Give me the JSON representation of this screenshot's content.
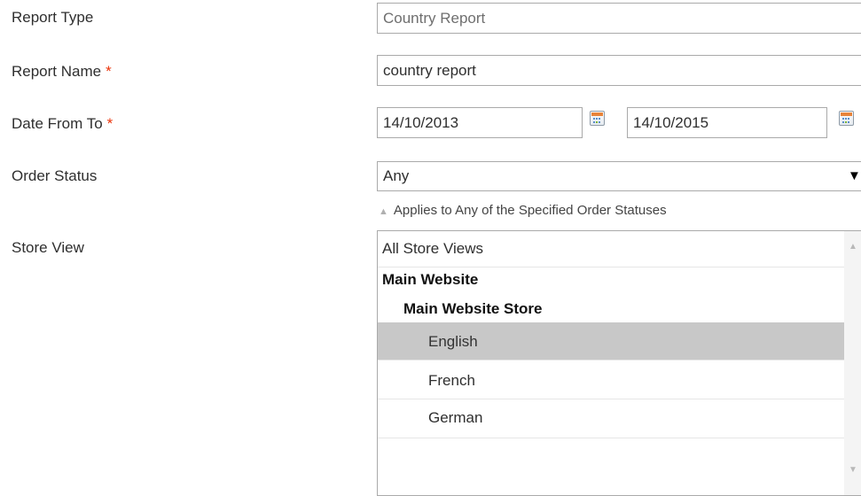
{
  "form": {
    "report_type": {
      "label": "Report Type",
      "value": "Country Report"
    },
    "report_name": {
      "label": "Report Name",
      "required_mark": "*",
      "value": "country report"
    },
    "date_range": {
      "label": "Date From To",
      "required_mark": "*",
      "from": "14/10/2013",
      "to": "14/10/2015"
    },
    "order_status": {
      "label": "Order Status",
      "selected": "Any",
      "dropdown_arrow": "▼",
      "note_icon": "▲",
      "note": "Applies to Any of the Specified Order Statuses"
    },
    "store_view": {
      "label": "Store View",
      "options": {
        "all": "All Store Views",
        "website": "Main Website",
        "store": "Main Website Store",
        "view_1": "English",
        "view_2": "French",
        "view_3": "German"
      },
      "selected": "English",
      "scroll_up": "▲",
      "scroll_down": "▼"
    }
  },
  "colors": {
    "required": "#eb340a",
    "selected_option_bg": "#c8c8c8",
    "border": "#aaaaaa"
  }
}
